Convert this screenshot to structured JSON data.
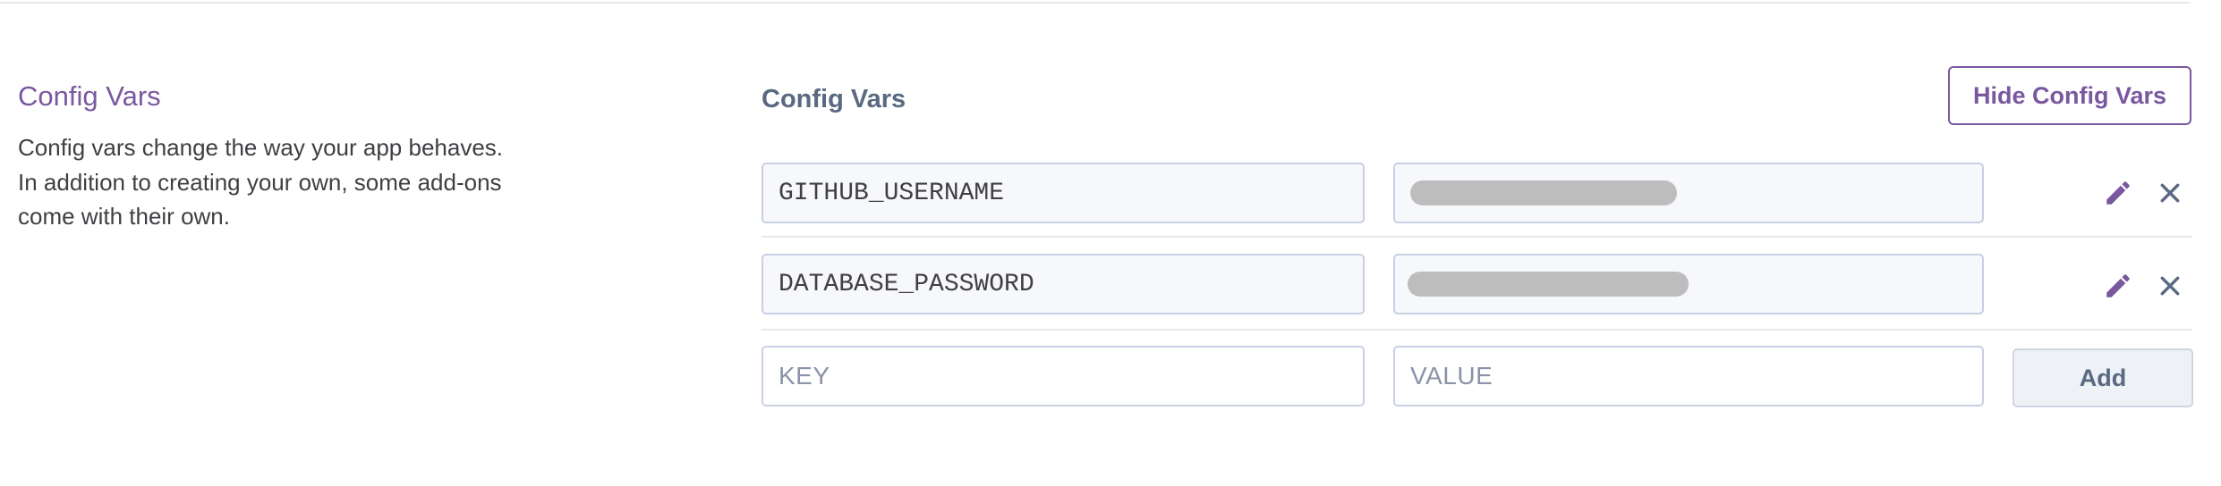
{
  "section": {
    "title": "Config Vars",
    "description": "Config vars change the way your app behaves. In addition to creating your own, some add-ons come with their own."
  },
  "panel": {
    "title": "Config Vars",
    "hide_button_label": "Hide Config Vars"
  },
  "vars": [
    {
      "key": "GITHUB_USERNAME",
      "value_state": "redacted"
    },
    {
      "key": "DATABASE_PASSWORD",
      "value_state": "redacted"
    }
  ],
  "new_var": {
    "key_placeholder": "KEY",
    "value_placeholder": "VALUE",
    "add_label": "Add"
  },
  "icons": {
    "edit": "pencil-icon",
    "delete": "close-icon"
  },
  "colors": {
    "accent": "#79589f",
    "muted_heading": "#596981",
    "field_border": "#c9d0e3",
    "field_bg": "#f7f8fb",
    "redaction": "#bdbdbd"
  }
}
